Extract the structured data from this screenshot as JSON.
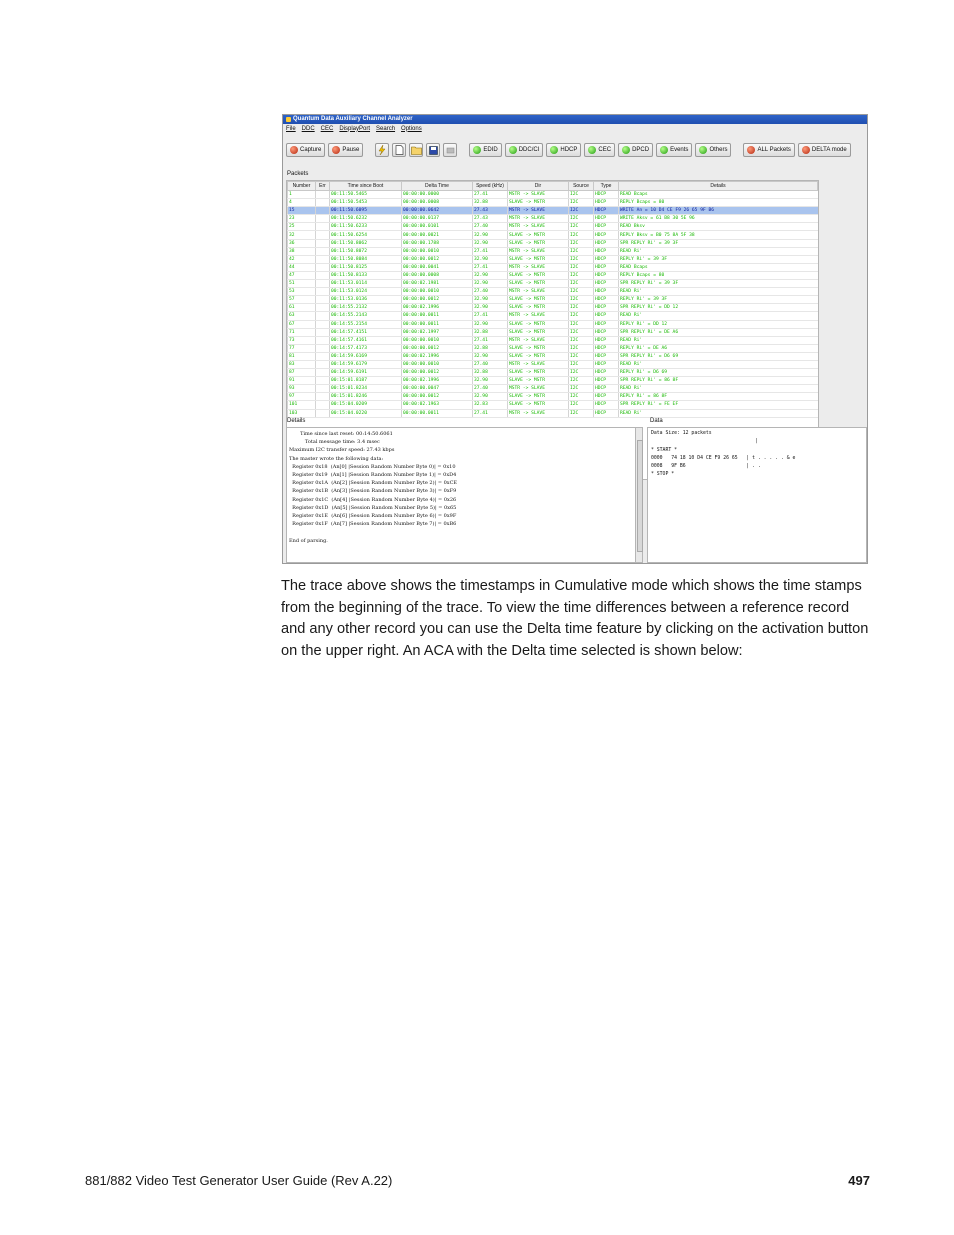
{
  "app": {
    "title": "Quantum Data Auxiliary Channel Analyzer",
    "menu": [
      "File",
      "DDC",
      "CEC",
      "DisplayPort",
      "Search",
      "Options"
    ],
    "toolbar": {
      "capture": "Capture",
      "pause": "Pause",
      "edid": "EDID",
      "ddcci": "DDC/CI",
      "hdcp": "HDCP",
      "cec": "CEC",
      "dpcd": "DPCD",
      "events": "Events",
      "others": "Others",
      "all_packets": "ALL Packets",
      "delta_mode": "DELTA mode"
    },
    "packets_label": "Packets",
    "columns": [
      "Number",
      "Err",
      "Time since Boot",
      "Delta Time",
      "Speed (kHz)",
      "Dir",
      "Source",
      "Type",
      "Details"
    ],
    "rows": [
      [
        "1",
        "",
        "00:11:50.5465",
        "00:00:00.0000",
        "27.41",
        "MSTR -> SLAVE",
        "I2C",
        "HDCP",
        "READ Bcaps"
      ],
      [
        "4",
        "",
        "00:11:50.5453",
        "00:00:00.0008",
        "32.88",
        "SLAVE -> MSTR",
        "I2C",
        "HDCP",
        "REPLY Bcaps = 80"
      ],
      [
        "15",
        "",
        "00:11:50.6095",
        "00:00:00.0642",
        "27.43",
        "MSTR -> SLAVE",
        "I2C",
        "HDCP",
        "WRITE An = 10 D4 CE F9 26 65 9F B6"
      ],
      [
        "23",
        "",
        "00:11:50.6232",
        "00:00:00.0137",
        "27.43",
        "MSTR -> SLAVE",
        "I2C",
        "HDCP",
        "WRITE Aksv = 61 B8 30 5E 96"
      ],
      [
        "25",
        "",
        "00:11:50.6233",
        "00:00:00.0101",
        "27.40",
        "MSTR -> SLAVE",
        "I2C",
        "HDCP",
        "READ Bksv"
      ],
      [
        "32",
        "",
        "00:11:50.6254",
        "00:00:00.0021",
        "32.90",
        "SLAVE -> MSTR",
        "I2C",
        "HDCP",
        "REPLY Bksv = B0 75 8A 5F 38"
      ],
      [
        "36",
        "",
        "00:11:50.8062",
        "00:00:00.1788",
        "32.90",
        "SLAVE -> MSTR",
        "I2C",
        "HDCP",
        "SPR REPLY Ri' = 39 3F"
      ],
      [
        "38",
        "",
        "00:11:50.8072",
        "00:00:00.0010",
        "27.41",
        "MSTR -> SLAVE",
        "I2C",
        "HDCP",
        "READ Ri'"
      ],
      [
        "42",
        "",
        "00:11:50.8084",
        "00:00:00.0012",
        "32.90",
        "SLAVE -> MSTR",
        "I2C",
        "HDCP",
        "REPLY Ri' = 39 3F"
      ],
      [
        "44",
        "",
        "00:11:50.8125",
        "00:00:00.0041",
        "27.41",
        "MSTR -> SLAVE",
        "I2C",
        "HDCP",
        "READ Bcaps"
      ],
      [
        "47",
        "",
        "00:11:50.8133",
        "00:00:00.0008",
        "32.90",
        "SLAVE -> MSTR",
        "I2C",
        "HDCP",
        "REPLY Bcaps = 80"
      ],
      [
        "51",
        "",
        "00:11:53.0114",
        "00:00:02.1981",
        "32.90",
        "SLAVE -> MSTR",
        "I2C",
        "HDCP",
        "SPR REPLY Ri' = 39 3F"
      ],
      [
        "53",
        "",
        "00:11:53.0124",
        "00:00:00.0010",
        "27.40",
        "MSTR -> SLAVE",
        "I2C",
        "HDCP",
        "READ Ri'"
      ],
      [
        "57",
        "",
        "00:11:53.0136",
        "00:00:00.0012",
        "32.90",
        "SLAVE -> MSTR",
        "I2C",
        "HDCP",
        "REPLY Ri' = 39 3F"
      ],
      [
        "61",
        "",
        "00:14:55.2132",
        "00:00:02.1996",
        "32.90",
        "SLAVE -> MSTR",
        "I2C",
        "HDCP",
        "SPR REPLY Ri' = DD 12"
      ],
      [
        "63",
        "",
        "00:14:55.2143",
        "00:00:00.0011",
        "27.41",
        "MSTR -> SLAVE",
        "I2C",
        "HDCP",
        "READ Ri'"
      ],
      [
        "67",
        "",
        "00:14:55.2154",
        "00:00:00.0011",
        "32.90",
        "SLAVE -> MSTR",
        "I2C",
        "HDCP",
        "REPLY Ri' = DD 12"
      ],
      [
        "71",
        "",
        "00:14:57.4151",
        "00:00:02.1997",
        "32.88",
        "SLAVE -> MSTR",
        "I2C",
        "HDCP",
        "SPR REPLY Ri' = DE A6"
      ],
      [
        "73",
        "",
        "00:14:57.4161",
        "00:00:00.0010",
        "27.41",
        "MSTR -> SLAVE",
        "I2C",
        "HDCP",
        "READ Ri'"
      ],
      [
        "77",
        "",
        "00:14:57.4173",
        "00:00:00.0012",
        "32.88",
        "SLAVE -> MSTR",
        "I2C",
        "HDCP",
        "REPLY Ri' = DE A6"
      ],
      [
        "81",
        "",
        "00:14:59.6169",
        "00:00:02.1996",
        "32.90",
        "SLAVE -> MSTR",
        "I2C",
        "HDCP",
        "SPR REPLY Ri' = D6 69"
      ],
      [
        "83",
        "",
        "00:14:59.6179",
        "00:00:00.0010",
        "27.40",
        "MSTR -> SLAVE",
        "I2C",
        "HDCP",
        "READ Ri'"
      ],
      [
        "87",
        "",
        "00:14:59.6191",
        "00:00:00.0012",
        "32.88",
        "SLAVE -> MSTR",
        "I2C",
        "HDCP",
        "REPLY Ri' = D6 69"
      ],
      [
        "91",
        "",
        "00:15:01.8187",
        "00:00:02.1996",
        "32.90",
        "SLAVE -> MSTR",
        "I2C",
        "HDCP",
        "SPR REPLY Ri' = 86 8F"
      ],
      [
        "93",
        "",
        "00:15:01.8234",
        "00:00:00.0047",
        "27.40",
        "MSTR -> SLAVE",
        "I2C",
        "HDCP",
        "READ Ri'"
      ],
      [
        "97",
        "",
        "00:15:01.8246",
        "00:00:00.0012",
        "32.90",
        "SLAVE -> MSTR",
        "I2C",
        "HDCP",
        "REPLY Ri' = 86 8F"
      ],
      [
        "101",
        "",
        "00:15:04.0209",
        "00:00:02.1963",
        "32.83",
        "SLAVE -> MSTR",
        "I2C",
        "HDCP",
        "SPR REPLY Ri' = FE EF"
      ],
      [
        "103",
        "",
        "00:15:04.0220",
        "00:00:00.0011",
        "27.41",
        "MSTR -> SLAVE",
        "I2C",
        "HDCP",
        "READ Ri'"
      ]
    ],
    "selected_row": 2,
    "details_label": "Details",
    "details_lines": [
      "       Time since last reset: 00:14:50.6061",
      "          Total message time: 3.4 msec",
      "Maximum I2C transfer speed: 27.43 kbps",
      "The master wrote the following data:",
      "  Register 0x18  (An[0] |Session Random Number Byte 0)| = 0x10",
      "  Register 0x19  (An[1] |Session Random Number Byte 1)| = 0xD4",
      "  Register 0x1A  (An[2] |Session Random Number Byte 2)| = 0xCE",
      "  Register 0x1B  (An[3] |Session Random Number Byte 3)| = 0xF9",
      "  Register 0x1C  (An[4] |Session Random Number Byte 4)| = 0x26",
      "  Register 0x1D  (An[5] |Session Random Number Byte 5)| = 0x65",
      "  Register 0x1E  (An[6] |Session Random Number Byte 6)| = 0x9F",
      "  Register 0x1F  (An[7] |Session Random Number Byte 7)| = 0xB6",
      "",
      "End of parsing."
    ],
    "data_label": "Data",
    "data_lines": [
      "Data Size: 12 packets",
      "                                    |",
      "* START *",
      "0000   74 18 10 D4 CE F9 26 65   | t . . . . . & e",
      "0008   9F B6                     | . .",
      "* STOP *"
    ],
    "colors": {
      "grid_text": "#17b800",
      "selected_bg": "#a9c4ee",
      "title_bar": "#2f63c8"
    }
  },
  "body_text": "The trace above shows the timestamps in Cumulative mode which shows the time stamps from the beginning of the trace. To view the time differences between a reference record and any other record you can use the Delta time feature by clicking on the activation button on the upper right. An ACA with the Delta time selected is shown below:",
  "footer": {
    "left": "881/882 Video Test Generator User Guide (Rev A.22)",
    "page": "497"
  }
}
